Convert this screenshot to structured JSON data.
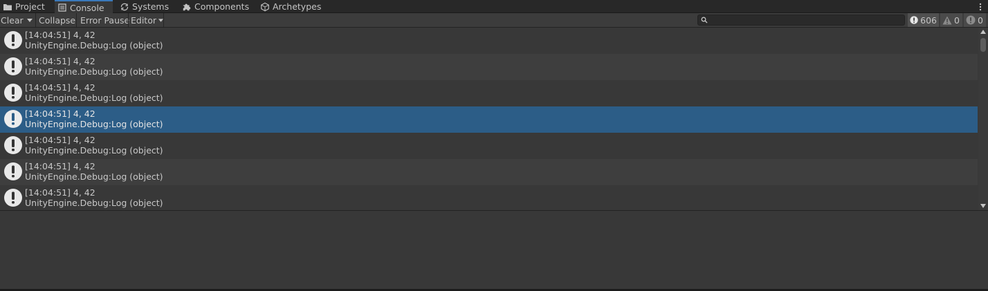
{
  "tabs": [
    {
      "label": "Project",
      "icon": "folder-icon"
    },
    {
      "label": "Console",
      "icon": "console-icon",
      "active": true
    },
    {
      "label": "Systems",
      "icon": "systems-icon"
    },
    {
      "label": "Components",
      "icon": "puzzle-icon"
    },
    {
      "label": "Archetypes",
      "icon": "archetypes-icon"
    }
  ],
  "toolbar": {
    "clear": "Clear",
    "collapse": "Collapse",
    "error_pause": "Error Pause",
    "editor": "Editor",
    "search_value": "",
    "counts": {
      "log": "606",
      "warning": "0",
      "error": "0"
    }
  },
  "log": {
    "entries": [
      {
        "line1": "[14:04:51] 4, 42",
        "line2": "UnityEngine.Debug:Log (object)"
      },
      {
        "line1": "[14:04:51] 4, 42",
        "line2": "UnityEngine.Debug:Log (object)"
      },
      {
        "line1": "[14:04:51] 4, 42",
        "line2": "UnityEngine.Debug:Log (object)"
      },
      {
        "line1": "[14:04:51] 4, 42",
        "line2": "UnityEngine.Debug:Log (object)",
        "selected": true
      },
      {
        "line1": "[14:04:51] 4, 42",
        "line2": "UnityEngine.Debug:Log (object)"
      },
      {
        "line1": "[14:04:51] 4, 42",
        "line2": "UnityEngine.Debug:Log (object)"
      },
      {
        "line1": "[14:04:51] 4, 42",
        "line2": "UnityEngine.Debug:Log (object)"
      }
    ]
  },
  "colors": {
    "accent": "#3a79bb",
    "selection": "#2c5d87"
  }
}
